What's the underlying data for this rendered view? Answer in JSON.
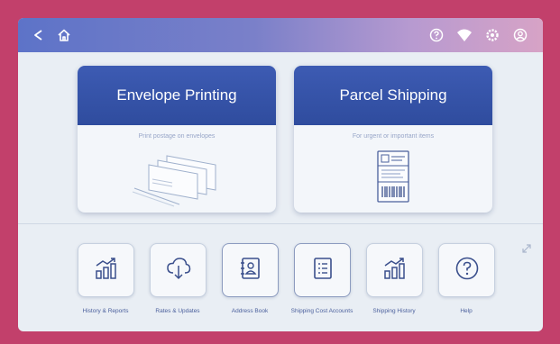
{
  "topbar": {
    "icons": [
      "back-icon",
      "home-icon",
      "help-icon",
      "wifi-icon",
      "settings-icon",
      "account-icon"
    ],
    "gradient": [
      "#5d73c8",
      "#b79ad0",
      "#d7a3c6"
    ]
  },
  "cards": [
    {
      "title": "Envelope Printing",
      "subtitle": "Print postage on envelopes"
    },
    {
      "title": "Parcel Shipping",
      "subtitle": "For urgent or important items"
    }
  ],
  "tiles": [
    {
      "label": "History & Reports",
      "icon": "chart-icon"
    },
    {
      "label": "Rates & Updates",
      "icon": "cloud-download-icon"
    },
    {
      "label": "Address Book",
      "icon": "address-book-icon"
    },
    {
      "label": "Shipping Cost Accounts",
      "icon": "checklist-icon"
    },
    {
      "label": "Shipping History",
      "icon": "chart-icon"
    },
    {
      "label": "Help",
      "icon": "question-icon"
    }
  ],
  "colors": {
    "frame": "#c2406b",
    "card_header": "#3253a8",
    "accent": "#4a5f9c",
    "screen": "#e9eef4"
  }
}
